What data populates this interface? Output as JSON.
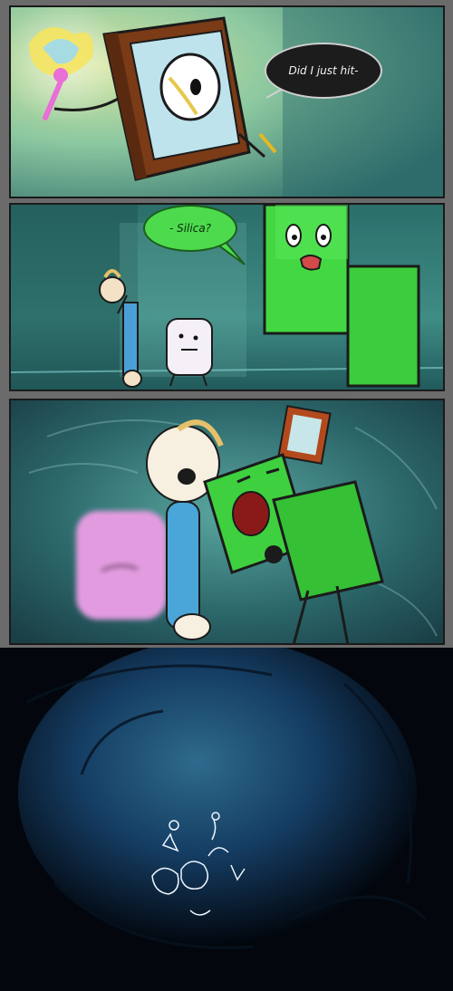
{
  "panel1": {
    "speech": "Did I just hit-"
  },
  "panel2": {
    "speech": "- Silica?"
  }
}
